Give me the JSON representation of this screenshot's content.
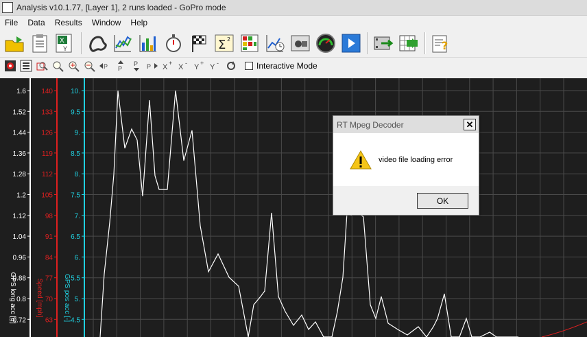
{
  "window": {
    "title": "Analysis v10.1.77, [Layer 1], 2 runs loaded - GoPro mode"
  },
  "menu": [
    "File",
    "Data",
    "Results",
    "Window",
    "Help"
  ],
  "toolbar": {
    "icons": [
      "open-folder-icon",
      "clipboard-icon",
      "excel-xy-icon",
      "track-map-icon",
      "line-graph-icon",
      "bar-graph-icon",
      "stopwatch-icon",
      "checkered-flag-icon",
      "sigma-icon",
      "calculator-grid-icon",
      "chart-clock-icon",
      "video-camera-icon",
      "gauge-icon",
      "play-icon",
      "video-export-icon",
      "grid-export-icon",
      "help-icon"
    ]
  },
  "toolbar2": {
    "icons": [
      "target-icon",
      "list-icon",
      "zoom-box-icon",
      "zoom-fit-icon",
      "zoom-in-icon",
      "zoom-out-icon",
      "pan-left-icon",
      "pan-up-icon",
      "pan-down-icon",
      "pan-right-icon",
      "x-plus-icon",
      "x-minus-icon",
      "y-plus-icon",
      "y-minus-icon",
      "refresh-icon"
    ],
    "interactive_mode_label": "Interactive Mode"
  },
  "axes": {
    "long_acc": {
      "label": "GPS long acc [g]",
      "color": "#ffffff",
      "ticks": [
        "1.6",
        "1.52",
        "1.44",
        "1.36",
        "1.28",
        "1.2",
        "1.12",
        "1.04",
        "0.96",
        "0.88",
        "0.8",
        "0.72"
      ]
    },
    "speed": {
      "label": "Speed [mph]",
      "color": "#e02020",
      "ticks": [
        "140",
        "133",
        "126",
        "119",
        "112",
        "105",
        "98",
        "91",
        "84",
        "77",
        "70",
        "63"
      ]
    },
    "pos_acc": {
      "label": "GPS pos acc [-]",
      "color": "#20d0e0",
      "ticks": [
        "10.",
        "9.5",
        "9.",
        "8.5",
        "8.",
        "7.5",
        "7.",
        "6.5",
        "6.",
        "5.5",
        "5.",
        "4.5"
      ]
    }
  },
  "dialog": {
    "title": "RT Mpeg Decoder",
    "message": "video file loading error",
    "ok_label": "OK"
  }
}
